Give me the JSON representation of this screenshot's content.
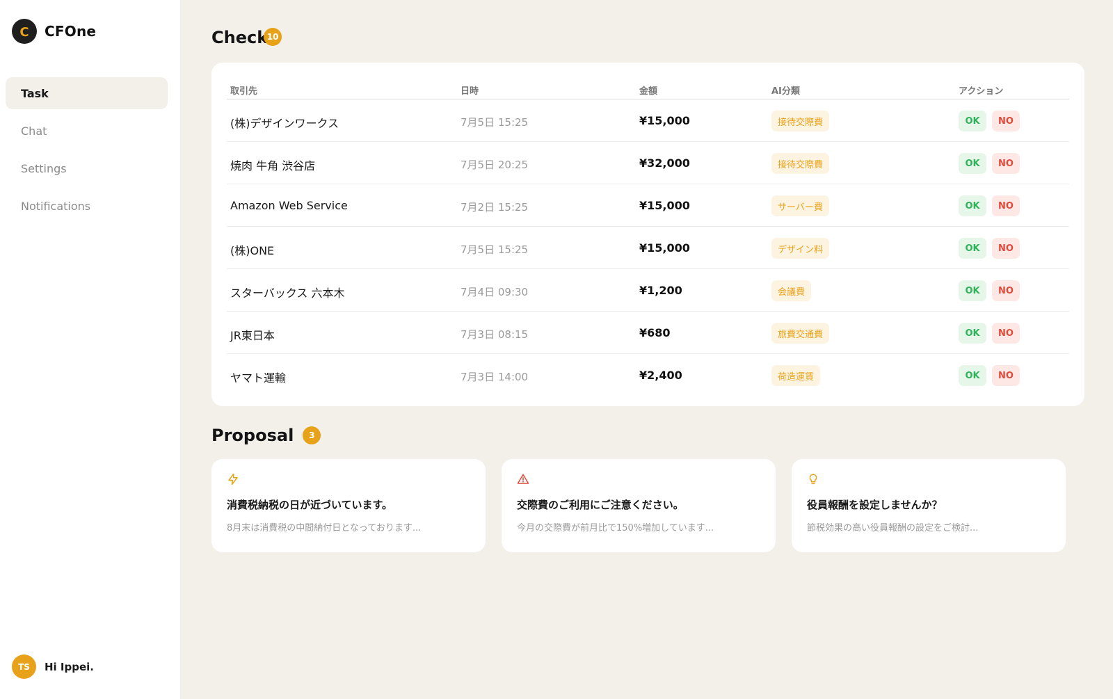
{
  "app": {
    "logo_letter": "C",
    "name": "CFOne"
  },
  "sidebar": {
    "items": [
      {
        "label": "Task",
        "active": true
      },
      {
        "label": "Chat",
        "active": false
      },
      {
        "label": "Settings",
        "active": false
      },
      {
        "label": "Notifications",
        "active": false
      }
    ]
  },
  "user": {
    "initials": "TS",
    "greeting": "Hi Ippei."
  },
  "check": {
    "title": "Check",
    "count": "10",
    "columns": [
      "取引先",
      "日時",
      "金額",
      "AI分類",
      "アクション"
    ],
    "ok_label": "OK",
    "no_label": "NO",
    "rows": [
      {
        "vendor": "(株)デザインワークス",
        "date": "7月5日 15:25",
        "amount": "¥15,000",
        "category": "接待交際費"
      },
      {
        "vendor": "焼肉 牛角 渋谷店",
        "date": "7月5日 20:25",
        "amount": "¥32,000",
        "category": "接待交際費"
      },
      {
        "vendor": "Amazon Web Service",
        "date": "7月2日 15:25",
        "amount": "¥15,000",
        "category": "サーバー費"
      },
      {
        "vendor": "(株)ONE",
        "date": "7月5日 15:25",
        "amount": "¥15,000",
        "category": "デザイン料"
      },
      {
        "vendor": "スターバックス 六本木",
        "date": "7月4日 09:30",
        "amount": "¥1,200",
        "category": "会議費"
      },
      {
        "vendor": "JR東日本",
        "date": "7月3日 08:15",
        "amount": "¥680",
        "category": "旅費交通費"
      },
      {
        "vendor": "ヤマト運輸",
        "date": "7月3日 14:00",
        "amount": "¥2,400",
        "category": "荷造運賃"
      }
    ]
  },
  "proposal": {
    "title": "Proposal",
    "count": "3",
    "cards": [
      {
        "icon": "lightning-icon",
        "icon_color": "#e8a21a",
        "title": "消費税納税の日が近づいています。",
        "desc": "8月末は消費税の中間納付日となっております..."
      },
      {
        "icon": "warning-icon",
        "icon_color": "#e04a3a",
        "title": "交際費のご利用にご注意ください。",
        "desc": "今月の交際費が前月比で150%増加しています..."
      },
      {
        "icon": "lightbulb-icon",
        "icon_color": "#e8a21a",
        "title": "役員報酬を設定しませんか？",
        "desc": "節税効果の高い役員報酬の設定をご検討..."
      }
    ]
  },
  "colors": {
    "accent": "#e8a21a",
    "background": "#f3f0ea",
    "ok_green": "#2fb35a",
    "no_red": "#e04a3a"
  }
}
